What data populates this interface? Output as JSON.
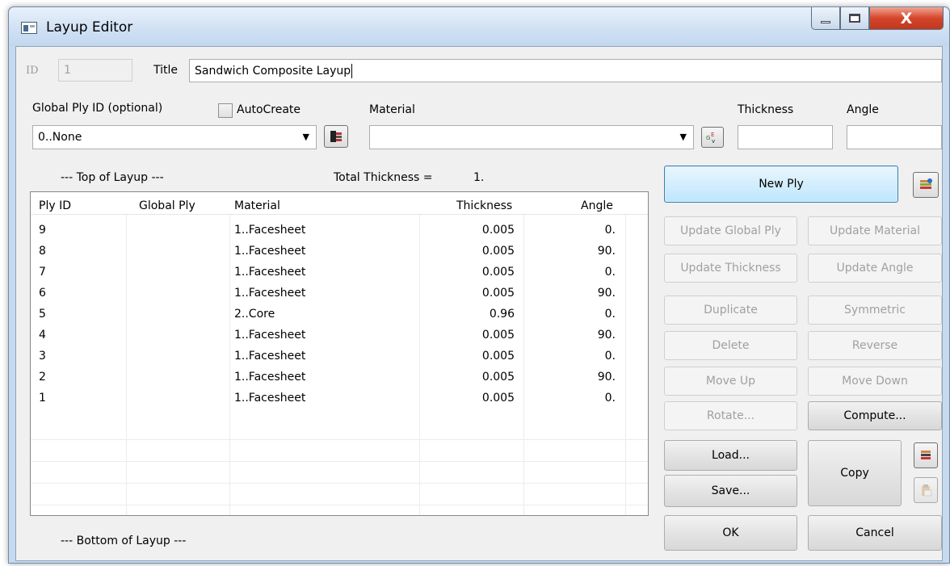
{
  "window": {
    "title": "Layup Editor",
    "close_glyph": "X"
  },
  "form": {
    "id_label": "ID",
    "id_value": "1",
    "title_label": "Title",
    "title_value": "Sandwich Composite Layup",
    "global_ply_label": "Global Ply ID (optional)",
    "global_ply_value": "0..None",
    "autocreate_label": "AutoCreate",
    "material_label": "Material",
    "material_value": "",
    "thickness_label": "Thickness",
    "thickness_value": "",
    "angle_label": "Angle",
    "angle_value": ""
  },
  "summary": {
    "top_label": "--- Top of Layup ---",
    "total_thickness_label": "Total Thickness =",
    "total_thickness_value": "1.",
    "bottom_label": "--- Bottom of Layup ---"
  },
  "table": {
    "columns": [
      "Ply ID",
      "Global Ply",
      "Material",
      "Thickness",
      "Angle"
    ],
    "rows": [
      [
        "9",
        "",
        "1..Facesheet",
        "0.005",
        "0."
      ],
      [
        "8",
        "",
        "1..Facesheet",
        "0.005",
        "90."
      ],
      [
        "7",
        "",
        "1..Facesheet",
        "0.005",
        "0."
      ],
      [
        "6",
        "",
        "1..Facesheet",
        "0.005",
        "90."
      ],
      [
        "5",
        "",
        "2..Core",
        "0.96",
        "0."
      ],
      [
        "4",
        "",
        "1..Facesheet",
        "0.005",
        "90."
      ],
      [
        "3",
        "",
        "1..Facesheet",
        "0.005",
        "0."
      ],
      [
        "2",
        "",
        "1..Facesheet",
        "0.005",
        "90."
      ],
      [
        "1",
        "",
        "1..Facesheet",
        "0.005",
        "0."
      ]
    ]
  },
  "buttons": {
    "new_ply": "New Ply",
    "update_global_ply": "Update Global Ply",
    "update_material": "Update Material",
    "update_thickness": "Update Thickness",
    "update_angle": "Update Angle",
    "duplicate": "Duplicate",
    "symmetric": "Symmetric",
    "delete": "Delete",
    "reverse": "Reverse",
    "move_up": "Move Up",
    "move_down": "Move Down",
    "rotate": "Rotate...",
    "compute": "Compute...",
    "load": "Load...",
    "save": "Save...",
    "copy": "Copy",
    "ok": "OK",
    "cancel": "Cancel"
  },
  "icons": [
    "app-icon",
    "minimize-icon",
    "maximize-icon",
    "close-icon",
    "global-ply-select-icon",
    "material-select-icon",
    "new-ply-options-icon",
    "copy-layup-icon",
    "paste-layup-icon",
    "dropdown-arrow-icon"
  ]
}
